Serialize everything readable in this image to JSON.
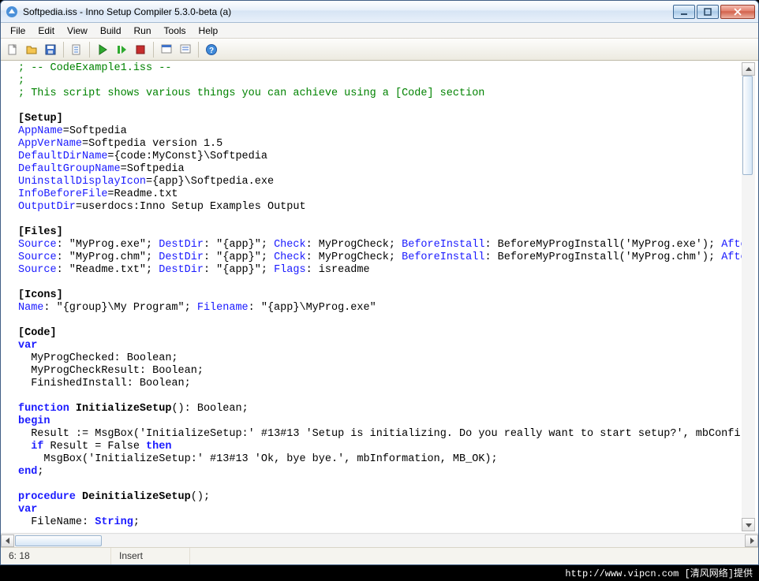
{
  "titlebar": {
    "title": "Softpedia.iss - Inno Setup Compiler 5.3.0-beta (a)"
  },
  "menubar": {
    "items": [
      "File",
      "Edit",
      "View",
      "Build",
      "Run",
      "Tools",
      "Help"
    ]
  },
  "toolbar": {
    "icons": [
      "new-icon",
      "open-icon",
      "save-icon",
      "compile-icon",
      "run-icon",
      "step-icon",
      "stop-icon",
      "target-icon",
      "help-icon"
    ]
  },
  "status": {
    "pos": "6:  18",
    "mode": "Insert"
  },
  "watermark": "http://www.vipcn.com [清风网络]提供",
  "code": {
    "l1": "; -- CodeExample1.iss --",
    "l2": ";",
    "l3": "; This script shows various things you can achieve using a [Code] section",
    "l4": "",
    "l5": "[Setup]",
    "l6a": "AppName",
    "l6b": "=Softpedia",
    "l7a": "AppVerName",
    "l7b": "=Softpedia version 1.5",
    "l8a": "DefaultDirName",
    "l8b": "={code:MyConst}\\Softpedia",
    "l9a": "DefaultGroupName",
    "l9b": "=Softpedia",
    "l10a": "UninstallDisplayIcon",
    "l10b": "={app}\\Softpedia.exe",
    "l11a": "InfoBeforeFile",
    "l11b": "=Readme.txt",
    "l12a": "OutputDir",
    "l12b": "=userdocs:Inno Setup Examples Output",
    "l13": "",
    "l14": "[Files]",
    "l15s": "Source",
    "l15a": ": \"MyProg.exe\"; ",
    "l15d": "DestDir",
    "l15b": ": \"{app}\"; ",
    "l15c": "Check",
    "l15e": ": MyProgCheck; ",
    "l15f": "BeforeInstall",
    "l15g": ": BeforeMyProgInstall('MyProg.exe'); ",
    "l15h": "Afte",
    "l16s": "Source",
    "l16a": ": \"MyProg.chm\"; ",
    "l16d": "DestDir",
    "l16b": ": \"{app}\"; ",
    "l16c": "Check",
    "l16e": ": MyProgCheck; ",
    "l16f": "BeforeInstall",
    "l16g": ": BeforeMyProgInstall('MyProg.chm'); ",
    "l16h": "Afte",
    "l17s": "Source",
    "l17a": ": \"Readme.txt\"; ",
    "l17d": "DestDir",
    "l17b": ": \"{app}\"; ",
    "l17c": "Flags",
    "l17e": ": isreadme",
    "l18": "",
    "l19": "[Icons]",
    "l20n": "Name",
    "l20a": ": \"{group}\\My Program\"; ",
    "l20f": "Filename",
    "l20b": ": \"{app}\\MyProg.exe\"",
    "l21": "",
    "l22": "[Code]",
    "l23": "var",
    "l24": "  MyProgChecked: Boolean;",
    "l25": "  MyProgCheckResult: Boolean;",
    "l26": "  FinishedInstall: Boolean;",
    "l27": "",
    "l28a": "function ",
    "l28b": "InitializeSetup",
    "l28c": "(): Boolean;",
    "l29": "begin",
    "l30a": "  Result := MsgBox(",
    "l30b": "'InitializeSetup:'",
    "l30c": " #13#13 ",
    "l30d": "'Setup is initializing. Do you really want to start setup?'",
    "l30e": ", mbConfir",
    "l31a": "  if ",
    "l31b": "Result = False ",
    "l31c": "then",
    "l32a": "    MsgBox(",
    "l32b": "'InitializeSetup:'",
    "l32c": " #13#13 ",
    "l32d": "'Ok, bye bye.'",
    "l32e": ", mbInformation, MB_OK);",
    "l33": "end",
    "l34": ";",
    "l35": "",
    "l36a": "procedure ",
    "l36b": "DeinitializeSetup",
    "l36c": "();",
    "l37": "var",
    "l38a": "  FileName: ",
    "l38b": "String",
    "l38c": ";"
  }
}
